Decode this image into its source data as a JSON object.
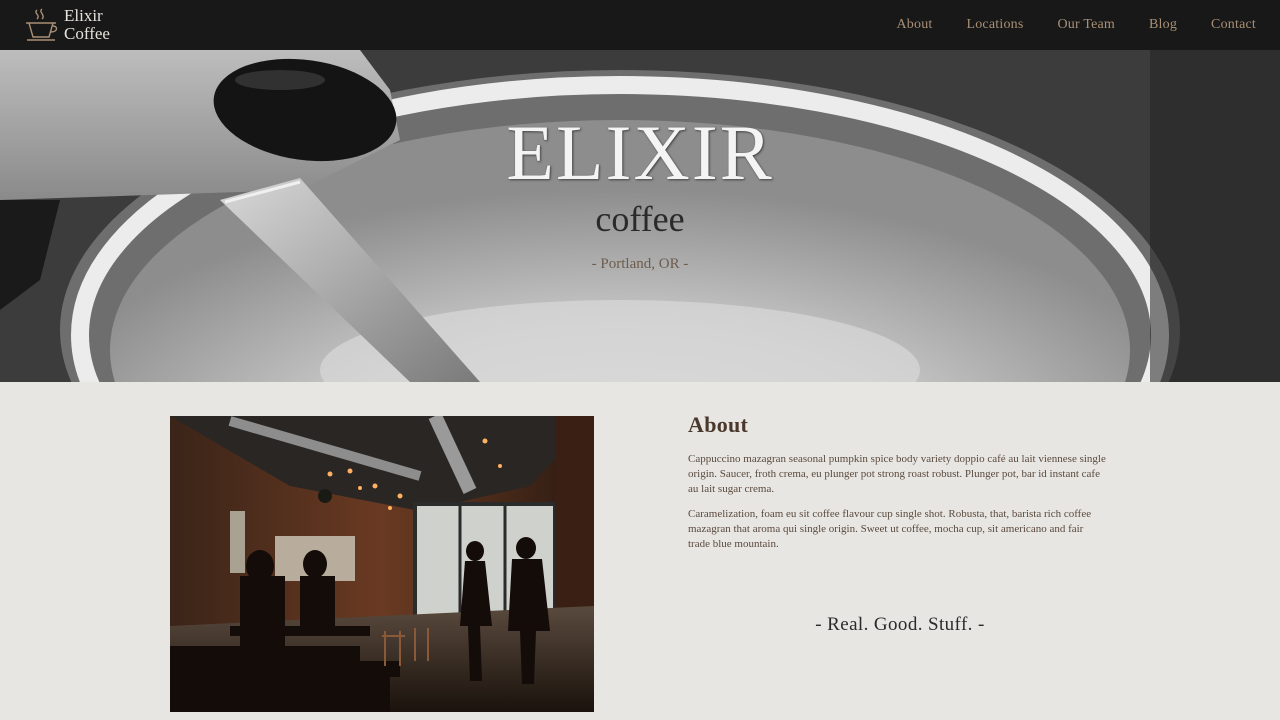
{
  "brand": {
    "line1": "Elixir",
    "line2": "Coffee",
    "icon": "coffee-cup-icon",
    "color": "#a89076"
  },
  "nav": {
    "items": [
      {
        "label": "About"
      },
      {
        "label": "Locations"
      },
      {
        "label": "Our Team"
      },
      {
        "label": "Blog"
      },
      {
        "label": "Contact"
      }
    ],
    "color": "#a89076"
  },
  "hero": {
    "title": "ELIXIR",
    "subtitle": "coffee",
    "location": "- Portland, OR -"
  },
  "about": {
    "heading": "About",
    "paragraphs": [
      "Cappuccino mazagran seasonal pumpkin spice body variety doppio café au lait viennese single origin. Saucer, froth crema, eu plunger pot strong roast robust. Plunger pot, bar id instant cafe au lait sugar crema.",
      "Caramelization, foam eu sit coffee flavour cup single shot. Robusta, that, barista rich coffee mazagran that aroma qui single origin. Sweet ut coffee, mocha cup, sit americano and fair trade blue mountain."
    ],
    "tagline": "- Real. Good. Stuff. -"
  },
  "colors": {
    "navbar": "#181818",
    "background": "#e8e6e2",
    "heading": "#4a382c"
  }
}
